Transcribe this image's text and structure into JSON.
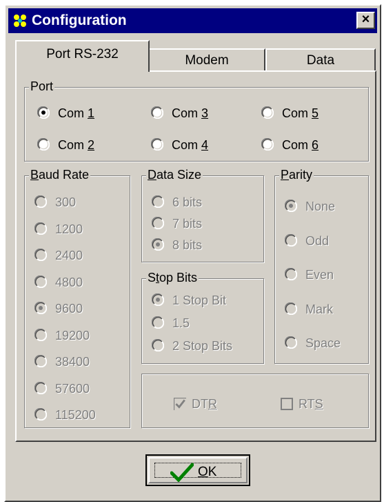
{
  "window": {
    "title": "Configuration",
    "close_label": "×"
  },
  "tabs": [
    {
      "label": "Port RS-232",
      "active": true
    },
    {
      "label": "Modem",
      "active": false
    },
    {
      "label": "Data",
      "active": false
    }
  ],
  "port": {
    "legend": "Port",
    "options": [
      {
        "pre": "Com ",
        "u": "1",
        "post": "",
        "checked": true
      },
      {
        "pre": "Com ",
        "u": "3",
        "post": "",
        "checked": false
      },
      {
        "pre": "Com ",
        "u": "5",
        "post": "",
        "checked": false
      },
      {
        "pre": "Com ",
        "u": "2",
        "post": "",
        "checked": false
      },
      {
        "pre": "Com ",
        "u": "4",
        "post": "",
        "checked": false
      },
      {
        "pre": "Com ",
        "u": "6",
        "post": "",
        "checked": false
      }
    ]
  },
  "baud": {
    "legend_u": "B",
    "legend_rest": "aud Rate",
    "options": [
      "300",
      "1200",
      "2400",
      "4800",
      "9600",
      "19200",
      "38400",
      "57600",
      "115200"
    ],
    "selected": "9600"
  },
  "data_size": {
    "legend_u": "D",
    "legend_rest": "ata Size",
    "options": [
      "6 bits",
      "7 bits",
      "8 bits"
    ],
    "selected": "8 bits"
  },
  "stop_bits": {
    "legend_pre": "S",
    "legend_u": "t",
    "legend_rest": "op Bits",
    "options": [
      "1 Stop Bit",
      "1.5",
      "2 Stop Bits"
    ],
    "selected": "1 Stop Bit"
  },
  "parity": {
    "legend_u": "P",
    "legend_rest": "arity",
    "options": [
      "None",
      "Odd",
      "Even",
      "Mark",
      "Space"
    ],
    "selected": "None"
  },
  "signals": {
    "dtr": {
      "pre": "DT",
      "u": "R",
      "checked": true
    },
    "rts": {
      "pre": "RT",
      "u": "S",
      "checked": false
    }
  },
  "ok_button": {
    "u": "O",
    "rest": "K"
  },
  "icons": {
    "app": "config-app-icon",
    "ok": "checkmark-icon"
  }
}
